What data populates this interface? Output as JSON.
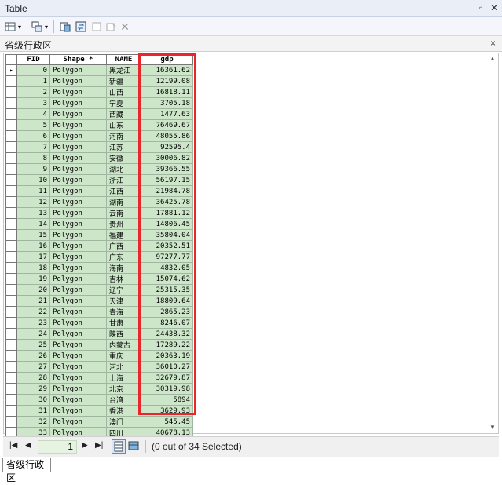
{
  "window": {
    "title": "Table"
  },
  "tab": {
    "title": "省级行政区",
    "close": "×"
  },
  "table": {
    "columns": [
      "FID",
      "Shape *",
      "NAME",
      "gdp"
    ],
    "rows": [
      {
        "fid": "0",
        "shape": "Polygon",
        "name": "黑龙江",
        "gdp": "16361.62"
      },
      {
        "fid": "1",
        "shape": "Polygon",
        "name": "新疆",
        "gdp": "12199.08"
      },
      {
        "fid": "2",
        "shape": "Polygon",
        "name": "山西",
        "gdp": "16818.11"
      },
      {
        "fid": "3",
        "shape": "Polygon",
        "name": "宁夏",
        "gdp": "3705.18"
      },
      {
        "fid": "4",
        "shape": "Polygon",
        "name": "西藏",
        "gdp": "1477.63"
      },
      {
        "fid": "5",
        "shape": "Polygon",
        "name": "山东",
        "gdp": "76469.67"
      },
      {
        "fid": "6",
        "shape": "Polygon",
        "name": "河南",
        "gdp": "48055.86"
      },
      {
        "fid": "7",
        "shape": "Polygon",
        "name": "江苏",
        "gdp": "92595.4"
      },
      {
        "fid": "8",
        "shape": "Polygon",
        "name": "安徽",
        "gdp": "30006.82"
      },
      {
        "fid": "9",
        "shape": "Polygon",
        "name": "湖北",
        "gdp": "39366.55"
      },
      {
        "fid": "10",
        "shape": "Polygon",
        "name": "浙江",
        "gdp": "56197.15"
      },
      {
        "fid": "11",
        "shape": "Polygon",
        "name": "江西",
        "gdp": "21984.78"
      },
      {
        "fid": "12",
        "shape": "Polygon",
        "name": "湖南",
        "gdp": "36425.78"
      },
      {
        "fid": "13",
        "shape": "Polygon",
        "name": "云南",
        "gdp": "17881.12"
      },
      {
        "fid": "14",
        "shape": "Polygon",
        "name": "贵州",
        "gdp": "14806.45"
      },
      {
        "fid": "15",
        "shape": "Polygon",
        "name": "福建",
        "gdp": "35804.04"
      },
      {
        "fid": "16",
        "shape": "Polygon",
        "name": "广西",
        "gdp": "20352.51"
      },
      {
        "fid": "17",
        "shape": "Polygon",
        "name": "广东",
        "gdp": "97277.77"
      },
      {
        "fid": "18",
        "shape": "Polygon",
        "name": "海南",
        "gdp": "4832.05"
      },
      {
        "fid": "19",
        "shape": "Polygon",
        "name": "吉林",
        "gdp": "15074.62"
      },
      {
        "fid": "20",
        "shape": "Polygon",
        "name": "辽宁",
        "gdp": "25315.35"
      },
      {
        "fid": "21",
        "shape": "Polygon",
        "name": "天津",
        "gdp": "18809.64"
      },
      {
        "fid": "22",
        "shape": "Polygon",
        "name": "青海",
        "gdp": "2865.23"
      },
      {
        "fid": "23",
        "shape": "Polygon",
        "name": "甘肃",
        "gdp": "8246.07"
      },
      {
        "fid": "24",
        "shape": "Polygon",
        "name": "陕西",
        "gdp": "24438.32"
      },
      {
        "fid": "25",
        "shape": "Polygon",
        "name": "内蒙古",
        "gdp": "17289.22"
      },
      {
        "fid": "26",
        "shape": "Polygon",
        "name": "重庆",
        "gdp": "20363.19"
      },
      {
        "fid": "27",
        "shape": "Polygon",
        "name": "河北",
        "gdp": "36010.27"
      },
      {
        "fid": "28",
        "shape": "Polygon",
        "name": "上海",
        "gdp": "32679.87"
      },
      {
        "fid": "29",
        "shape": "Polygon",
        "name": "北京",
        "gdp": "30319.98"
      },
      {
        "fid": "30",
        "shape": "Polygon",
        "name": "台湾",
        "gdp": "5894"
      },
      {
        "fid": "31",
        "shape": "Polygon",
        "name": "香港",
        "gdp": "3629.93"
      },
      {
        "fid": "32",
        "shape": "Polygon",
        "name": "澳门",
        "gdp": "545.45"
      },
      {
        "fid": "33",
        "shape": "Polygon",
        "name": "四川",
        "gdp": "40678.13"
      }
    ],
    "current_row_marker": "▸"
  },
  "navigation": {
    "page": "1",
    "status": "(0 out of 34 Selected)"
  },
  "bottom_tab": {
    "label": "省级行政区"
  },
  "colors": {
    "row_bg": "#cde6c9",
    "highlight": "#e8262b"
  }
}
